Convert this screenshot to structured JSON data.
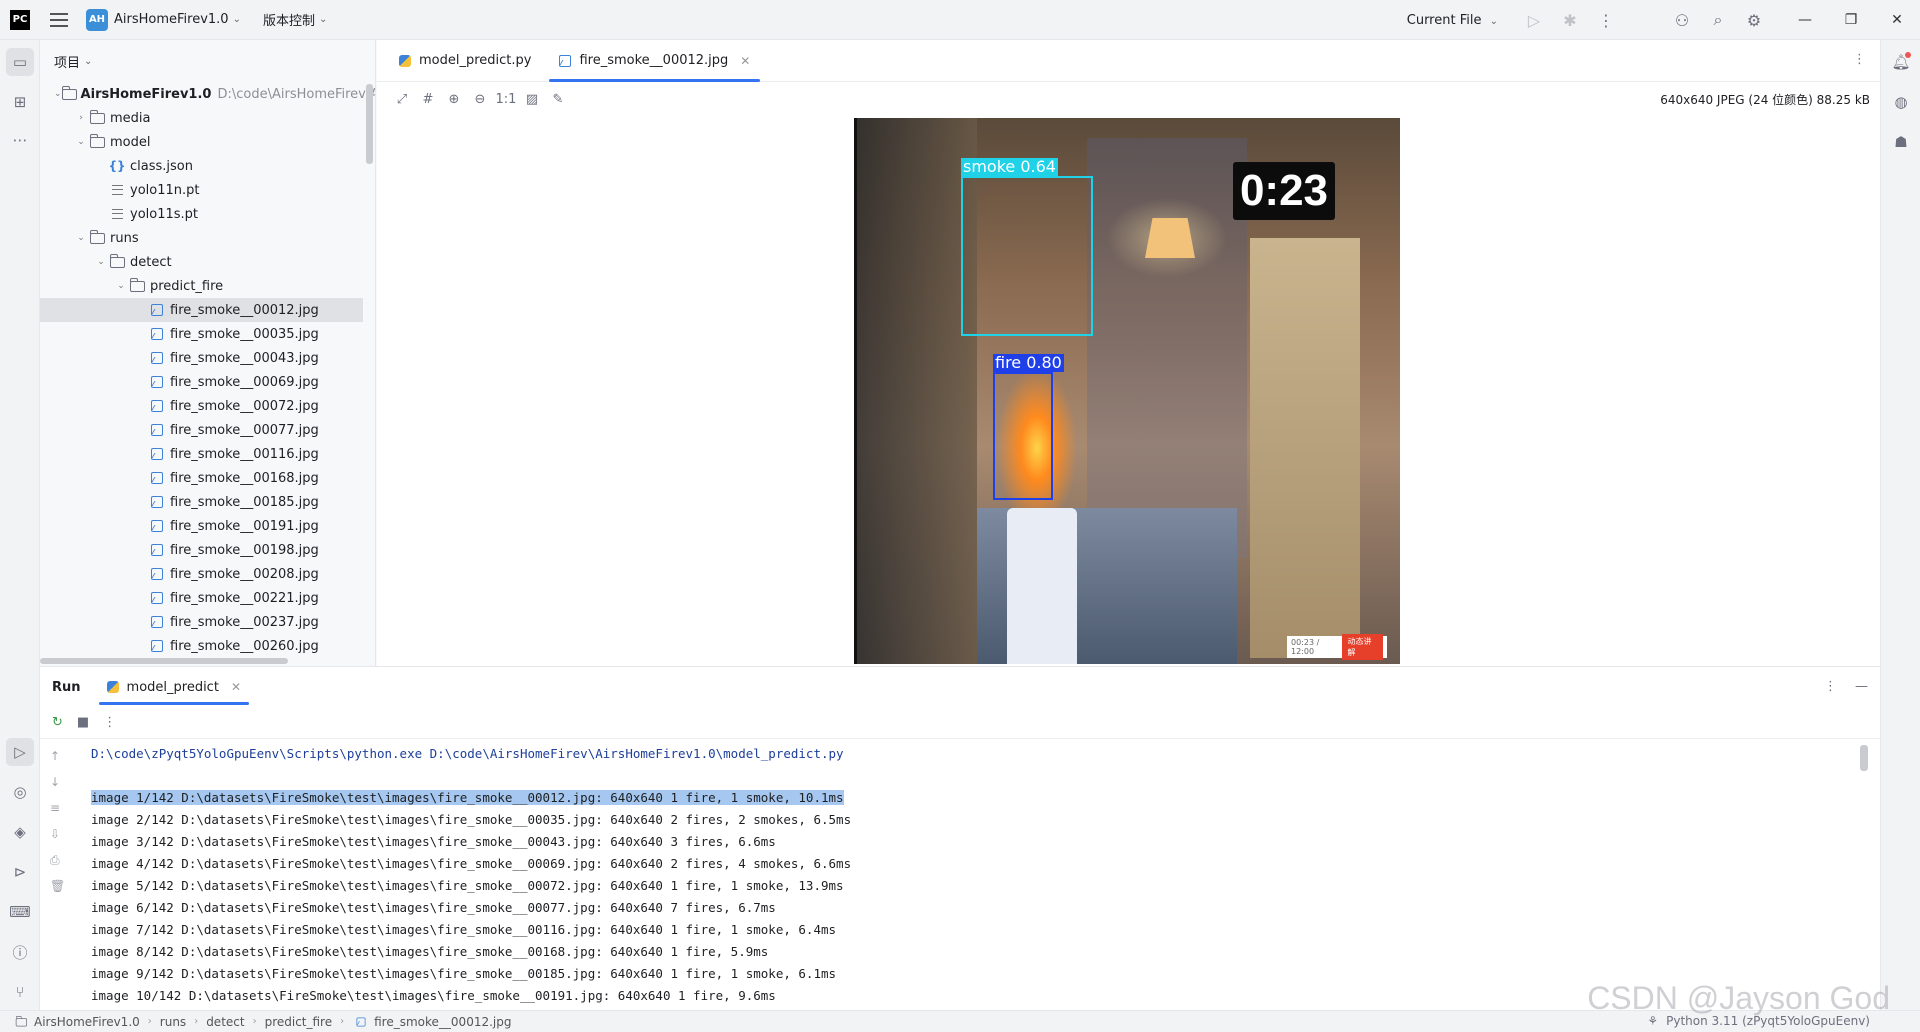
{
  "titlebar": {
    "logo": "PC",
    "project_badge": "AH",
    "project_name": "AirsHomeFirev1.0",
    "vcs_label": "版本控制",
    "run_config": "Current File"
  },
  "project_panel": {
    "header": "项目",
    "root": {
      "name": "AirsHomeFirev1.0",
      "path": "D:\\code\\AirsHomeFirev\\AirsH"
    },
    "items": [
      {
        "label": "media",
        "type": "folder",
        "depth": 1,
        "expanded": false
      },
      {
        "label": "model",
        "type": "folder",
        "depth": 1,
        "expanded": true
      },
      {
        "label": "class.json",
        "type": "json",
        "depth": 2
      },
      {
        "label": "yolo11n.pt",
        "type": "file",
        "depth": 2
      },
      {
        "label": "yolo11s.pt",
        "type": "file",
        "depth": 2
      },
      {
        "label": "runs",
        "type": "folder",
        "depth": 1,
        "expanded": true
      },
      {
        "label": "detect",
        "type": "folder",
        "depth": 2,
        "expanded": true
      },
      {
        "label": "predict_fire",
        "type": "folder",
        "depth": 3,
        "expanded": true
      },
      {
        "label": "fire_smoke__00012.jpg",
        "type": "image",
        "depth": 4,
        "selected": true
      },
      {
        "label": "fire_smoke__00035.jpg",
        "type": "image",
        "depth": 4
      },
      {
        "label": "fire_smoke__00043.jpg",
        "type": "image",
        "depth": 4
      },
      {
        "label": "fire_smoke__00069.jpg",
        "type": "image",
        "depth": 4
      },
      {
        "label": "fire_smoke__00072.jpg",
        "type": "image",
        "depth": 4
      },
      {
        "label": "fire_smoke__00077.jpg",
        "type": "image",
        "depth": 4
      },
      {
        "label": "fire_smoke__00116.jpg",
        "type": "image",
        "depth": 4
      },
      {
        "label": "fire_smoke__00168.jpg",
        "type": "image",
        "depth": 4
      },
      {
        "label": "fire_smoke__00185.jpg",
        "type": "image",
        "depth": 4
      },
      {
        "label": "fire_smoke__00191.jpg",
        "type": "image",
        "depth": 4
      },
      {
        "label": "fire_smoke__00198.jpg",
        "type": "image",
        "depth": 4
      },
      {
        "label": "fire_smoke__00208.jpg",
        "type": "image",
        "depth": 4
      },
      {
        "label": "fire_smoke__00221.jpg",
        "type": "image",
        "depth": 4
      },
      {
        "label": "fire_smoke__00237.jpg",
        "type": "image",
        "depth": 4
      },
      {
        "label": "fire_smoke__00260.jpg",
        "type": "image",
        "depth": 4
      }
    ]
  },
  "editor": {
    "tabs": [
      {
        "label": "model_predict.py",
        "active": false
      },
      {
        "label": "fire_smoke__00012.jpg",
        "active": true
      }
    ],
    "zoom_actual": "1:1",
    "image_info": "640x640 JPEG (24 位颜色) 88.25 kB",
    "image": {
      "timer_text": "0:23",
      "detections": [
        {
          "label": "smoke  0.64",
          "class": "smoke"
        },
        {
          "label": "fire  0.80",
          "class": "fire"
        }
      ],
      "player_time": "00:23 / 12:00",
      "player_button": "动态讲解"
    }
  },
  "run_panel": {
    "label": "Run",
    "tab": "model_predict",
    "lines": [
      "D:\\code\\zPyqt5YoloGpuEenv\\Scripts\\python.exe D:\\code\\AirsHomeFirev\\AirsHomeFirev1.0\\model_predict.py",
      "",
      "image 1/142 D:\\datasets\\FireSmoke\\test\\images\\fire_smoke__00012.jpg: 640x640 1 fire, 1 smoke, 10.1ms",
      "image 2/142 D:\\datasets\\FireSmoke\\test\\images\\fire_smoke__00035.jpg: 640x640 2 fires, 2 smokes, 6.5ms",
      "image 3/142 D:\\datasets\\FireSmoke\\test\\images\\fire_smoke__00043.jpg: 640x640 3 fires, 6.6ms",
      "image 4/142 D:\\datasets\\FireSmoke\\test\\images\\fire_smoke__00069.jpg: 640x640 2 fires, 4 smokes, 6.6ms",
      "image 5/142 D:\\datasets\\FireSmoke\\test\\images\\fire_smoke__00072.jpg: 640x640 1 fire, 1 smoke, 13.9ms",
      "image 6/142 D:\\datasets\\FireSmoke\\test\\images\\fire_smoke__00077.jpg: 640x640 7 fires, 6.7ms",
      "image 7/142 D:\\datasets\\FireSmoke\\test\\images\\fire_smoke__00116.jpg: 640x640 1 fire, 1 smoke, 6.4ms",
      "image 8/142 D:\\datasets\\FireSmoke\\test\\images\\fire_smoke__00168.jpg: 640x640 1 fire, 5.9ms",
      "image 9/142 D:\\datasets\\FireSmoke\\test\\images\\fire_smoke__00185.jpg: 640x640 1 fire, 1 smoke, 6.1ms",
      "image 10/142 D:\\datasets\\FireSmoke\\test\\images\\fire_smoke__00191.jpg: 640x640 1 fire, 9.6ms"
    ]
  },
  "statusbar": {
    "breadcrumbs": [
      "AirsHomeFirev1.0",
      "runs",
      "detect",
      "predict_fire",
      "fire_smoke__00012.jpg"
    ],
    "interpreter": "Python 3.11 (zPyqt5YoloGpuEenv)"
  },
  "watermark": "CSDN @Jayson God",
  "colors": {
    "accent": "#3574f0",
    "smoke_box": "#1fd2e8",
    "fire_box": "#1f3fe8",
    "selection": "#a6c8f0"
  }
}
